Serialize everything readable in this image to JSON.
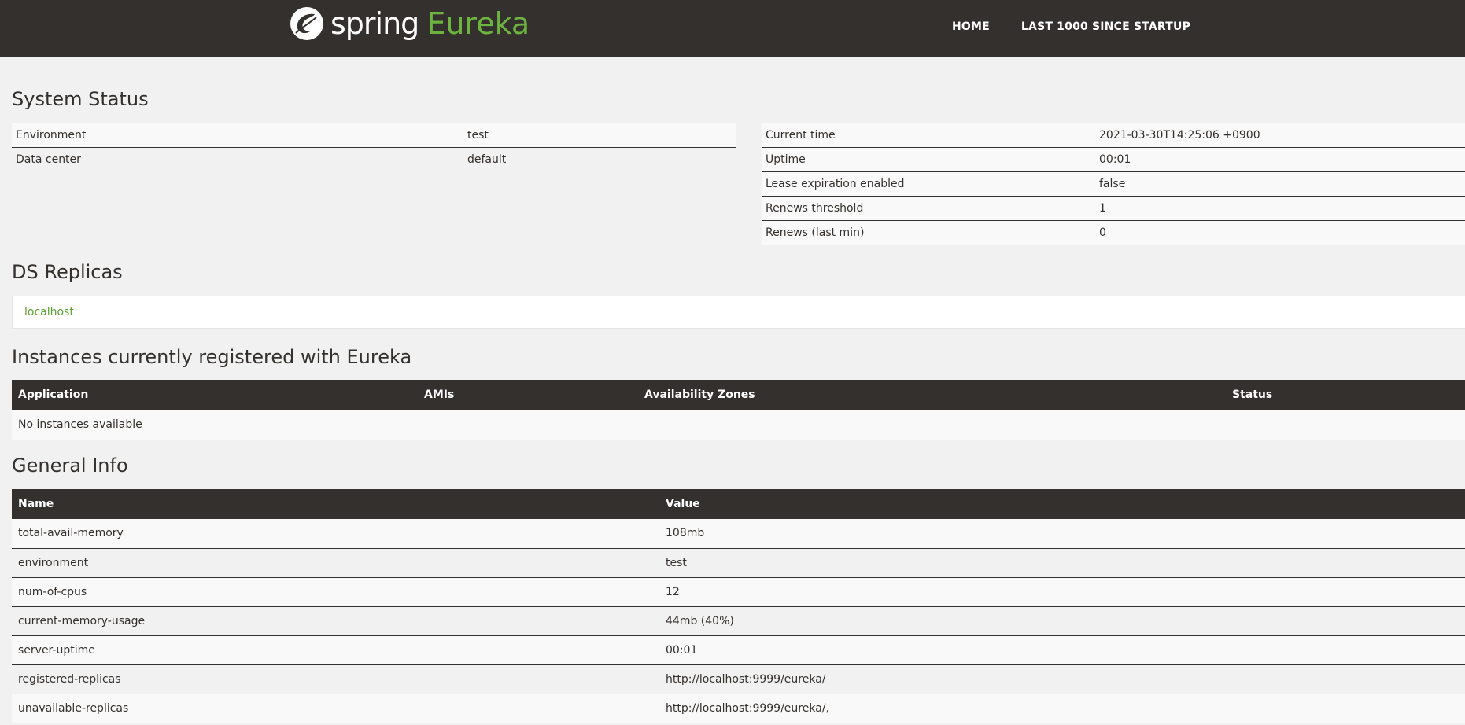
{
  "brand": {
    "word1": "spring",
    "word2": "Eureka"
  },
  "nav": {
    "home": "HOME",
    "last1000": "LAST 1000 SINCE STARTUP"
  },
  "system_status": {
    "title": "System Status",
    "left": [
      {
        "label": "Environment",
        "value": "test"
      },
      {
        "label": "Data center",
        "value": "default"
      }
    ],
    "right": [
      {
        "label": "Current time",
        "value": "2021-03-30T14:25:06 +0900"
      },
      {
        "label": "Uptime",
        "value": "00:01"
      },
      {
        "label": "Lease expiration enabled",
        "value": "false"
      },
      {
        "label": "Renews threshold",
        "value": "1"
      },
      {
        "label": "Renews (last min)",
        "value": "0"
      }
    ]
  },
  "ds_replicas": {
    "title": "DS Replicas",
    "items": [
      "localhost"
    ]
  },
  "instances": {
    "title": "Instances currently registered with Eureka",
    "headers": [
      "Application",
      "AMIs",
      "Availability Zones",
      "Status"
    ],
    "empty_text": "No instances available"
  },
  "general_info": {
    "title": "General Info",
    "headers": [
      "Name",
      "Value"
    ],
    "rows": [
      {
        "name": "total-avail-memory",
        "value": "108mb"
      },
      {
        "name": "environment",
        "value": "test"
      },
      {
        "name": "num-of-cpus",
        "value": "12"
      },
      {
        "name": "current-memory-usage",
        "value": "44mb (40%)"
      },
      {
        "name": "server-uptime",
        "value": "00:01"
      },
      {
        "name": "registered-replicas",
        "value": "http://localhost:9999/eureka/"
      },
      {
        "name": "unavailable-replicas",
        "value": "http://localhost:9999/eureka/,"
      }
    ]
  },
  "colors": {
    "nav_bg": "#34302d",
    "accent_green": "#6db33f",
    "page_bg": "#f1f1f1"
  }
}
